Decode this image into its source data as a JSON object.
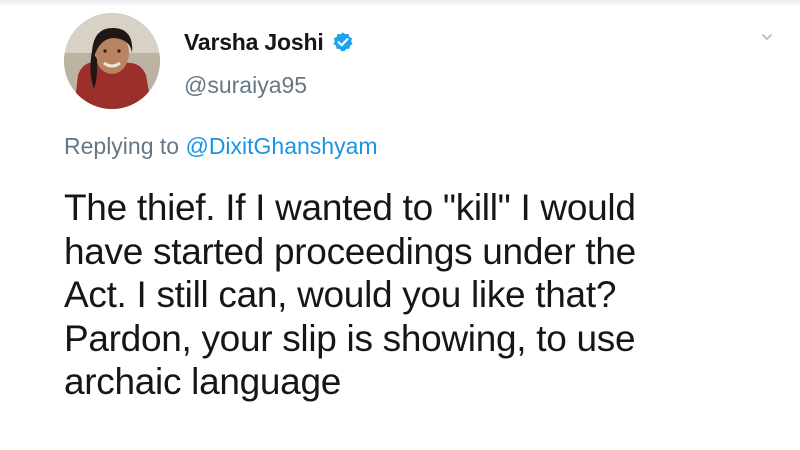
{
  "tweet": {
    "author": {
      "display_name": "Varsha Joshi",
      "handle": "@suraiya95",
      "verified": true,
      "avatar_icon": "profile-photo",
      "badge_color": "#1da1f2"
    },
    "reply": {
      "prefix": "Replying to ",
      "mention": "@DixitGhanshyam"
    },
    "text_lines": [
      "The thief. If I wanted to \"kill\" I would",
      "have started proceedings under the",
      "Act. I still can, would you like that?",
      "Pardon, your slip is showing, to use",
      "archaic language"
    ],
    "menu_icon": "chevron-down-icon",
    "colors": {
      "text": "#14171a",
      "secondary": "#657786",
      "link": "#1b95e0"
    }
  }
}
